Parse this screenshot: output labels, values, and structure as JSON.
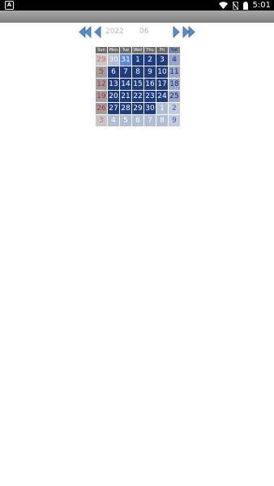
{
  "status_bar": {
    "notification_letter": "A",
    "time": "5:01"
  },
  "calendar": {
    "year": "2022",
    "month": "06",
    "weekdays": [
      "Sun",
      "Mon",
      "Tue",
      "Wed",
      "Thu",
      "Fri",
      "Sat"
    ],
    "weeks": [
      [
        "29",
        "30",
        "31",
        "1",
        "2",
        "3",
        "4"
      ],
      [
        "5",
        "6",
        "7",
        "8",
        "9",
        "10",
        "11"
      ],
      [
        "12",
        "13",
        "14",
        "15",
        "16",
        "17",
        "18"
      ],
      [
        "19",
        "20",
        "21",
        "22",
        "23",
        "24",
        "25"
      ],
      [
        "26",
        "27",
        "28",
        "29",
        "30",
        "1",
        "2"
      ],
      [
        "3",
        "4",
        "5",
        "6",
        "7",
        "8",
        "9"
      ]
    ]
  }
}
